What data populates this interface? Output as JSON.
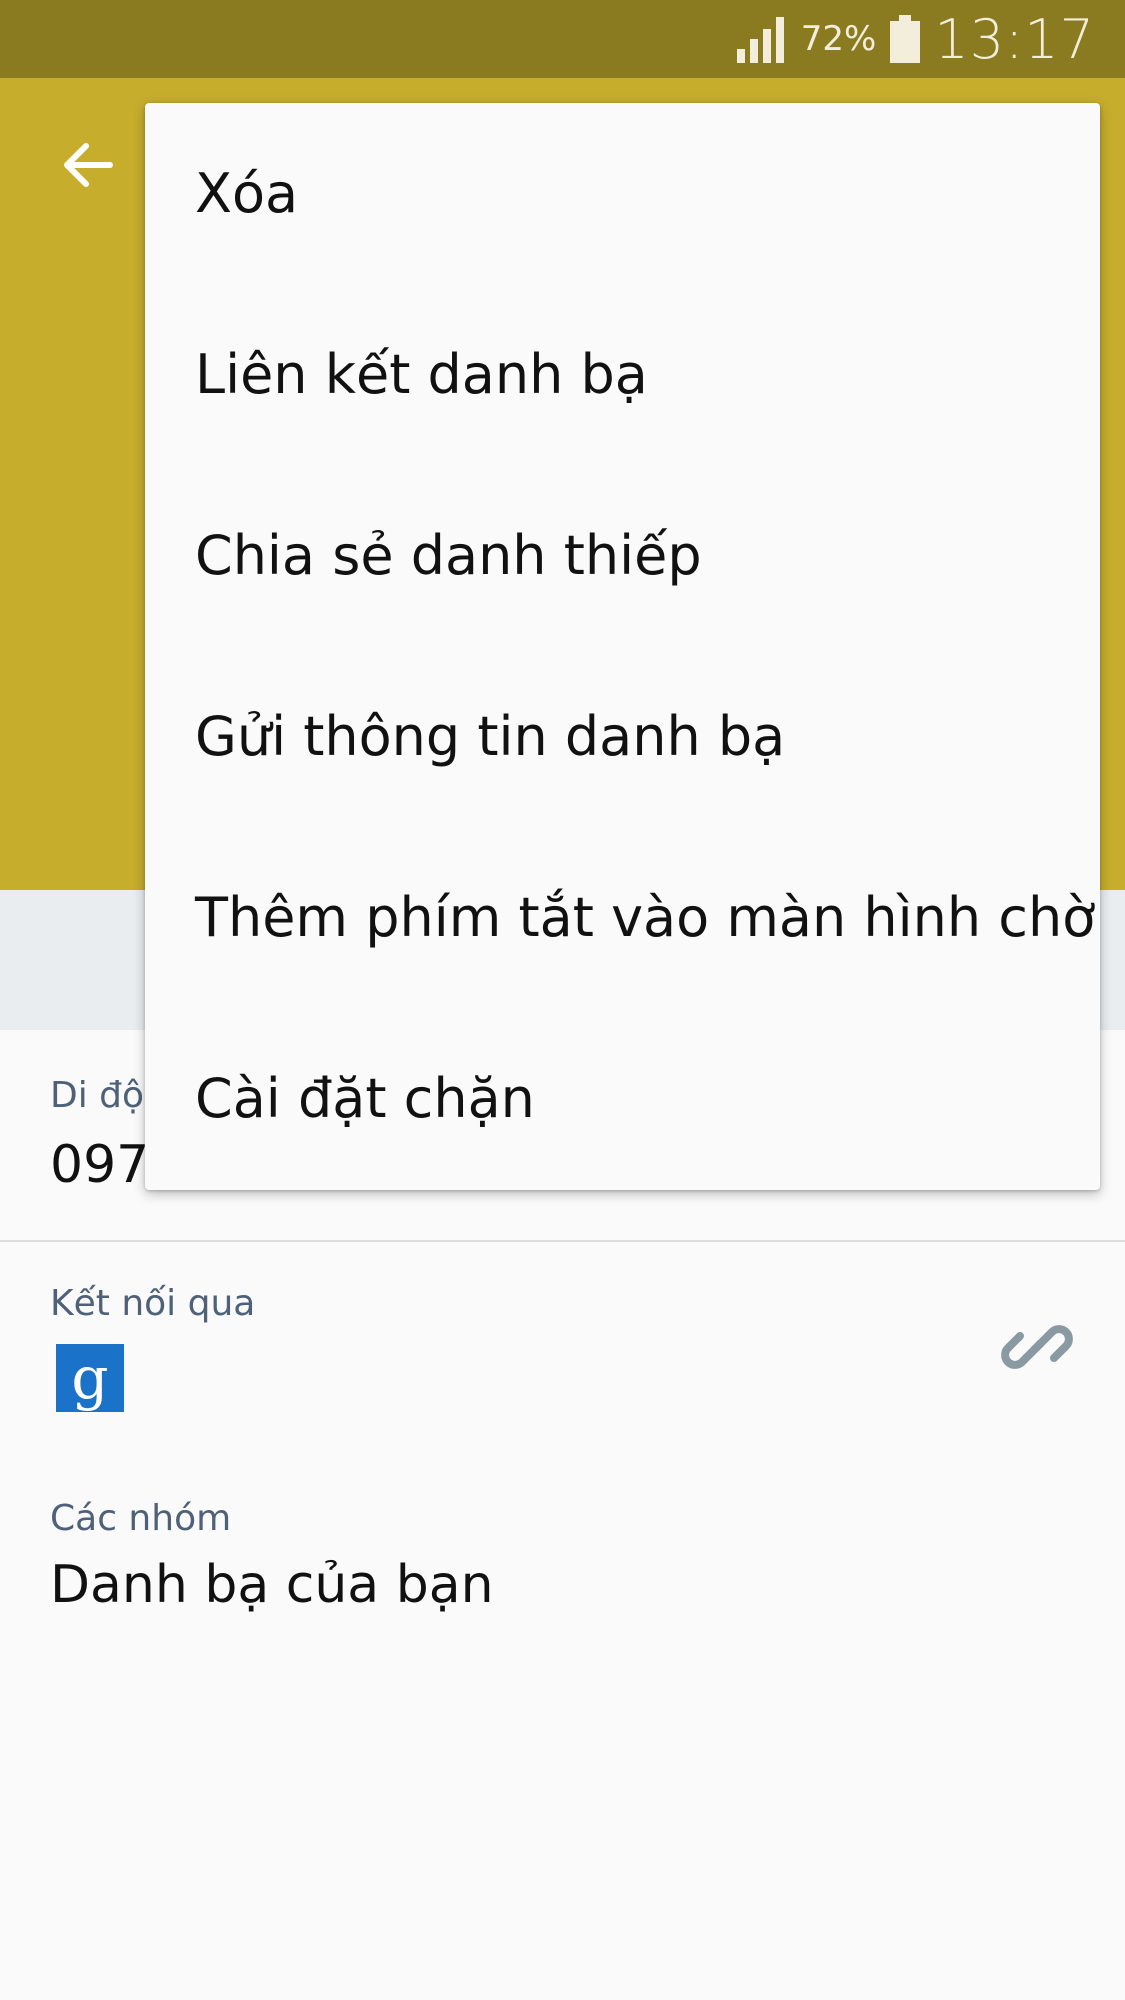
{
  "status_bar": {
    "battery_percent": "72%",
    "time": "13:17",
    "signal_icon": "signal-icon",
    "battery_icon": "battery-icon"
  },
  "header": {
    "back_icon": "arrow-left-icon",
    "color": "#c6ad2c"
  },
  "phone": {
    "label_partial": "Di độ",
    "value_partial": "097"
  },
  "connected_via": {
    "label": "Kết nối qua",
    "service_letter": "g",
    "link_icon": "link-icon"
  },
  "groups": {
    "label": "Các nhóm",
    "value": "Danh bạ của bạn"
  },
  "menu": {
    "items": [
      {
        "label": "Xóa"
      },
      {
        "label": "Liên kết danh bạ"
      },
      {
        "label": "Chia sẻ danh thiếp"
      },
      {
        "label": "Gửi thông tin danh bạ"
      },
      {
        "label": "Thêm phím tắt vào màn hình chờ"
      },
      {
        "label": "Cài đặt chặn"
      }
    ]
  }
}
